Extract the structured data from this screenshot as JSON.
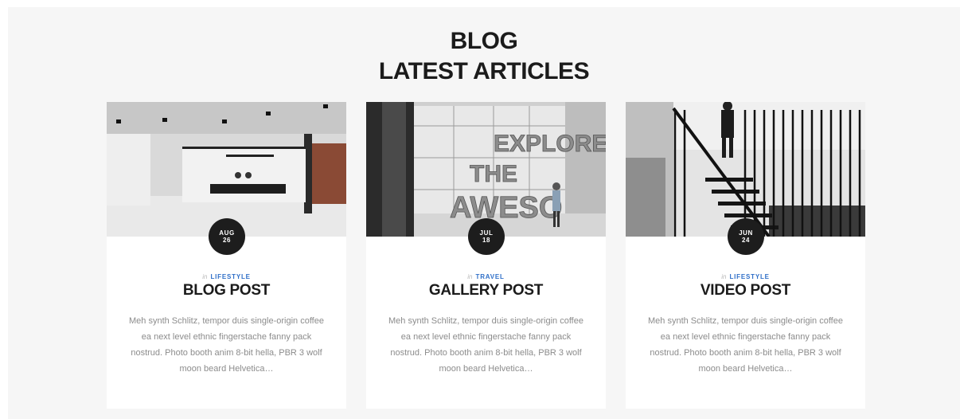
{
  "section": {
    "title_line1": "BLOG",
    "title_line2": "LATEST ARTICLES"
  },
  "posts": [
    {
      "month": "AUG",
      "day": "26",
      "category_prefix": "in",
      "category": "LIFESTYLE",
      "title": "BLOG POST",
      "excerpt": "Meh synth Schlitz, tempor duis single-origin coffee ea next level ethnic fingerstache fanny pack nostrud. Photo booth anim 8-bit hella, PBR 3 wolf moon beard Helvetica…",
      "image": "office-meeting-room-photo"
    },
    {
      "month": "JUL",
      "day": "18",
      "category_prefix": "in",
      "category": "TRAVEL",
      "title": "GALLERY POST",
      "excerpt": "Meh synth Schlitz, tempor duis single-origin coffee ea next level ethnic fingerstache fanny pack nostrud. Photo booth anim 8-bit hella, PBR 3 wolf moon beard Helvetica…",
      "image": "explore-the-awesome-wall-photo",
      "image_text": [
        "EXPLORE",
        "THE",
        "AWESO"
      ]
    },
    {
      "month": "JUN",
      "day": "24",
      "category_prefix": "in",
      "category": "LIFESTYLE",
      "title": "VIDEO POST",
      "excerpt": "Meh synth Schlitz, tempor duis single-origin coffee ea next level ethnic fingerstache fanny pack nostrud. Photo booth anim 8-bit hella, PBR 3 wolf moon beard Helvetica…",
      "image": "staircase-photo"
    }
  ],
  "colors": {
    "background": "#f6f6f6",
    "card": "#ffffff",
    "accent": "#2f6fc8",
    "dark": "#1d1d1d"
  }
}
